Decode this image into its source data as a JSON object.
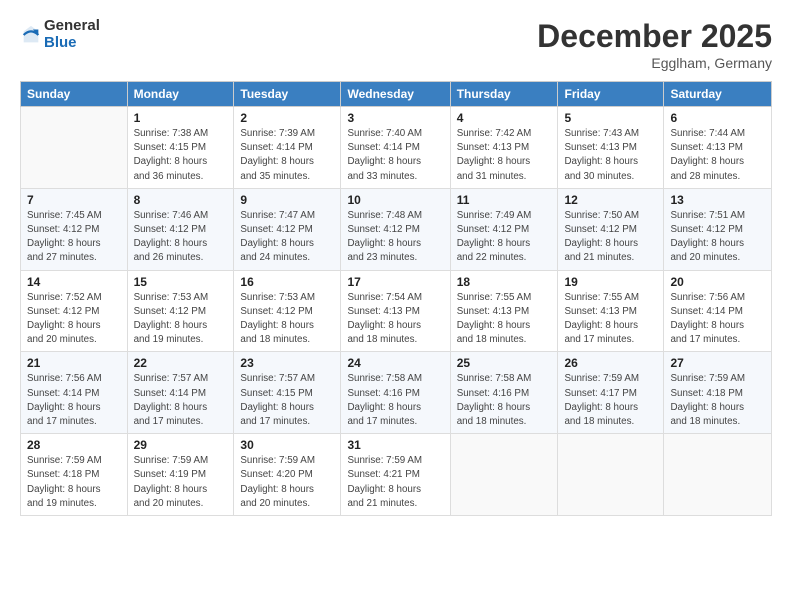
{
  "header": {
    "logo_general": "General",
    "logo_blue": "Blue",
    "month_title": "December 2025",
    "location": "Egglham, Germany"
  },
  "days_of_week": [
    "Sunday",
    "Monday",
    "Tuesday",
    "Wednesday",
    "Thursday",
    "Friday",
    "Saturday"
  ],
  "weeks": [
    [
      {
        "day": "",
        "info": ""
      },
      {
        "day": "1",
        "info": "Sunrise: 7:38 AM\nSunset: 4:15 PM\nDaylight: 8 hours\nand 36 minutes."
      },
      {
        "day": "2",
        "info": "Sunrise: 7:39 AM\nSunset: 4:14 PM\nDaylight: 8 hours\nand 35 minutes."
      },
      {
        "day": "3",
        "info": "Sunrise: 7:40 AM\nSunset: 4:14 PM\nDaylight: 8 hours\nand 33 minutes."
      },
      {
        "day": "4",
        "info": "Sunrise: 7:42 AM\nSunset: 4:13 PM\nDaylight: 8 hours\nand 31 minutes."
      },
      {
        "day": "5",
        "info": "Sunrise: 7:43 AM\nSunset: 4:13 PM\nDaylight: 8 hours\nand 30 minutes."
      },
      {
        "day": "6",
        "info": "Sunrise: 7:44 AM\nSunset: 4:13 PM\nDaylight: 8 hours\nand 28 minutes."
      }
    ],
    [
      {
        "day": "7",
        "info": "Sunrise: 7:45 AM\nSunset: 4:12 PM\nDaylight: 8 hours\nand 27 minutes."
      },
      {
        "day": "8",
        "info": "Sunrise: 7:46 AM\nSunset: 4:12 PM\nDaylight: 8 hours\nand 26 minutes."
      },
      {
        "day": "9",
        "info": "Sunrise: 7:47 AM\nSunset: 4:12 PM\nDaylight: 8 hours\nand 24 minutes."
      },
      {
        "day": "10",
        "info": "Sunrise: 7:48 AM\nSunset: 4:12 PM\nDaylight: 8 hours\nand 23 minutes."
      },
      {
        "day": "11",
        "info": "Sunrise: 7:49 AM\nSunset: 4:12 PM\nDaylight: 8 hours\nand 22 minutes."
      },
      {
        "day": "12",
        "info": "Sunrise: 7:50 AM\nSunset: 4:12 PM\nDaylight: 8 hours\nand 21 minutes."
      },
      {
        "day": "13",
        "info": "Sunrise: 7:51 AM\nSunset: 4:12 PM\nDaylight: 8 hours\nand 20 minutes."
      }
    ],
    [
      {
        "day": "14",
        "info": "Sunrise: 7:52 AM\nSunset: 4:12 PM\nDaylight: 8 hours\nand 20 minutes."
      },
      {
        "day": "15",
        "info": "Sunrise: 7:53 AM\nSunset: 4:12 PM\nDaylight: 8 hours\nand 19 minutes."
      },
      {
        "day": "16",
        "info": "Sunrise: 7:53 AM\nSunset: 4:12 PM\nDaylight: 8 hours\nand 18 minutes."
      },
      {
        "day": "17",
        "info": "Sunrise: 7:54 AM\nSunset: 4:13 PM\nDaylight: 8 hours\nand 18 minutes."
      },
      {
        "day": "18",
        "info": "Sunrise: 7:55 AM\nSunset: 4:13 PM\nDaylight: 8 hours\nand 18 minutes."
      },
      {
        "day": "19",
        "info": "Sunrise: 7:55 AM\nSunset: 4:13 PM\nDaylight: 8 hours\nand 17 minutes."
      },
      {
        "day": "20",
        "info": "Sunrise: 7:56 AM\nSunset: 4:14 PM\nDaylight: 8 hours\nand 17 minutes."
      }
    ],
    [
      {
        "day": "21",
        "info": "Sunrise: 7:56 AM\nSunset: 4:14 PM\nDaylight: 8 hours\nand 17 minutes."
      },
      {
        "day": "22",
        "info": "Sunrise: 7:57 AM\nSunset: 4:14 PM\nDaylight: 8 hours\nand 17 minutes."
      },
      {
        "day": "23",
        "info": "Sunrise: 7:57 AM\nSunset: 4:15 PM\nDaylight: 8 hours\nand 17 minutes."
      },
      {
        "day": "24",
        "info": "Sunrise: 7:58 AM\nSunset: 4:16 PM\nDaylight: 8 hours\nand 17 minutes."
      },
      {
        "day": "25",
        "info": "Sunrise: 7:58 AM\nSunset: 4:16 PM\nDaylight: 8 hours\nand 18 minutes."
      },
      {
        "day": "26",
        "info": "Sunrise: 7:59 AM\nSunset: 4:17 PM\nDaylight: 8 hours\nand 18 minutes."
      },
      {
        "day": "27",
        "info": "Sunrise: 7:59 AM\nSunset: 4:18 PM\nDaylight: 8 hours\nand 18 minutes."
      }
    ],
    [
      {
        "day": "28",
        "info": "Sunrise: 7:59 AM\nSunset: 4:18 PM\nDaylight: 8 hours\nand 19 minutes."
      },
      {
        "day": "29",
        "info": "Sunrise: 7:59 AM\nSunset: 4:19 PM\nDaylight: 8 hours\nand 20 minutes."
      },
      {
        "day": "30",
        "info": "Sunrise: 7:59 AM\nSunset: 4:20 PM\nDaylight: 8 hours\nand 20 minutes."
      },
      {
        "day": "31",
        "info": "Sunrise: 7:59 AM\nSunset: 4:21 PM\nDaylight: 8 hours\nand 21 minutes."
      },
      {
        "day": "",
        "info": ""
      },
      {
        "day": "",
        "info": ""
      },
      {
        "day": "",
        "info": ""
      }
    ]
  ]
}
